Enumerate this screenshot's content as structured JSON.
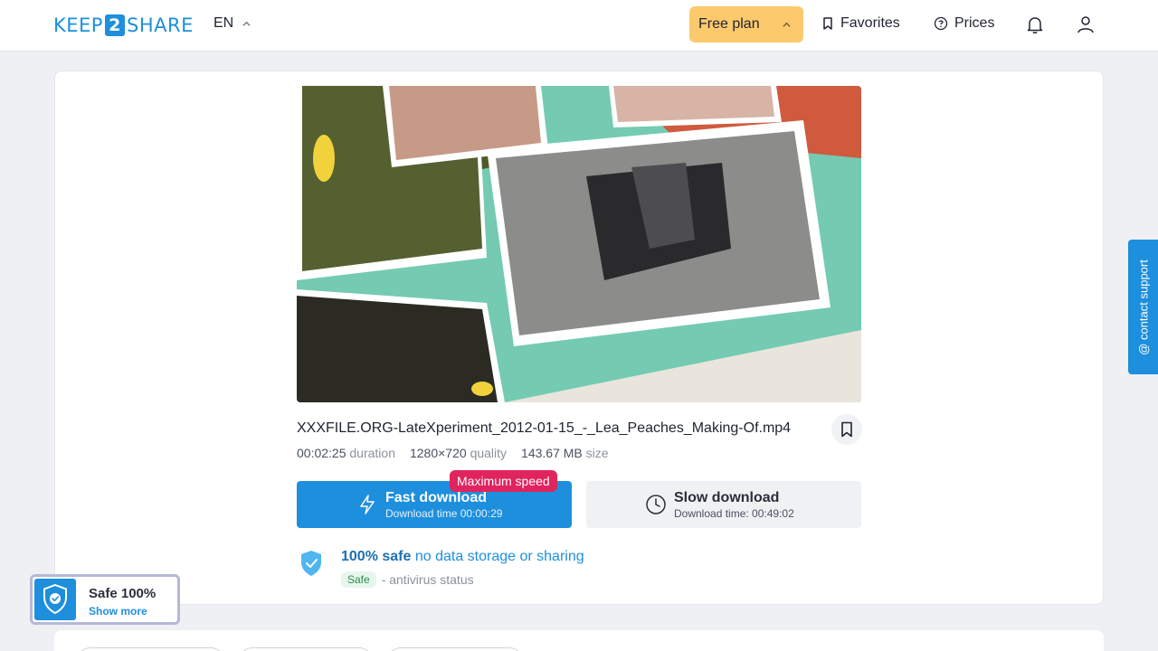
{
  "header": {
    "logo_left": "KEEP",
    "logo_mid": "2",
    "logo_right": "SHARE",
    "lang": "EN",
    "plan": "Free plan",
    "favorites": "Favorites",
    "prices": "Prices"
  },
  "file": {
    "name": "XXXFILE.ORG-LateXperiment_2012-01-15_-_Lea_Peaches_Making-Of.mp4",
    "duration": "00:02:25",
    "duration_label": "duration",
    "quality": "1280×720",
    "quality_label": "quality",
    "size": "143.67 MB",
    "size_label": "size"
  },
  "download": {
    "fast_title": "Fast download",
    "fast_time": "Download time 00:00:29",
    "badge": "Maximum speed",
    "slow_title": "Slow download",
    "slow_time": "Download time: 00:49:02"
  },
  "safety": {
    "bold": "100% safe",
    "rest": "no data storage or sharing",
    "pill": "Safe",
    "status": "- antivirus status"
  },
  "widget": {
    "title": "Safe 100%",
    "link": "Show more"
  },
  "contact": "@ contact support",
  "colors": {
    "accent": "#1d8fdc",
    "plan": "#fcc96d",
    "badge": "#e0245e"
  }
}
